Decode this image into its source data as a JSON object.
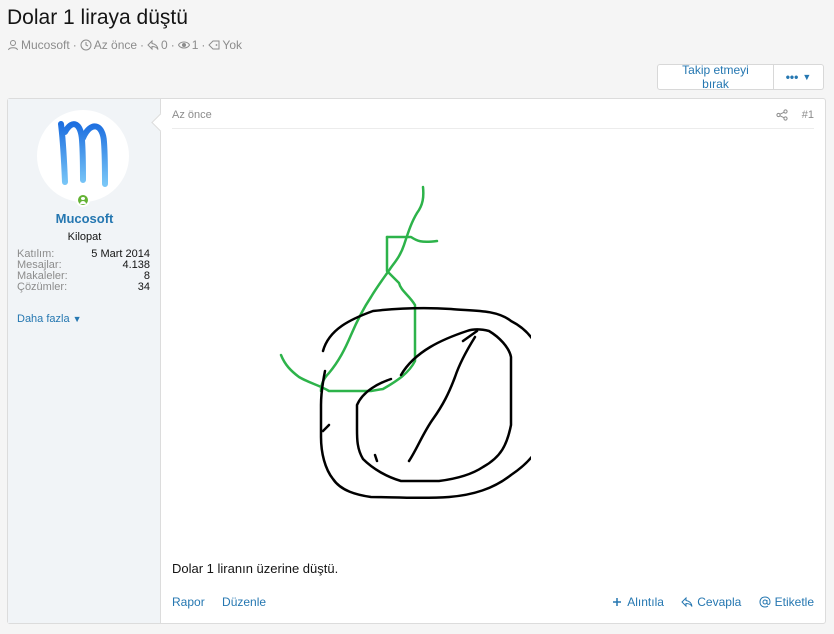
{
  "thread": {
    "title": "Dolar 1 liraya düştü",
    "meta": {
      "author": "Mucosoft",
      "time": "Az önce",
      "replies": "0",
      "views": "1",
      "tags": "Yok"
    }
  },
  "actions": {
    "unfollow_label": "Takip etmeyi bırak",
    "more_label": "•••"
  },
  "user": {
    "name": "Mucosoft",
    "title": "Kilopat",
    "avatar_letter": "m",
    "stats": [
      {
        "label": "Katılım:",
        "value": "5 Mart 2014"
      },
      {
        "label": "Mesajlar:",
        "value": "4.138"
      },
      {
        "label": "Makaleler:",
        "value": "8"
      },
      {
        "label": "Çözümler:",
        "value": "34"
      }
    ],
    "more_label": "Daha fazla"
  },
  "post": {
    "time": "Az önce",
    "number": "#1",
    "body": "Dolar 1 liranın üzerine düştü.",
    "footer_left": [
      "Rapor",
      "Düzenle"
    ],
    "footer_right": [
      "Alıntıla",
      "Cevapla",
      "Etiketle"
    ]
  },
  "colors": {
    "accent": "#2577b1",
    "online": "#63b233",
    "drawing_green": "#2db34a",
    "drawing_black": "#000000"
  }
}
